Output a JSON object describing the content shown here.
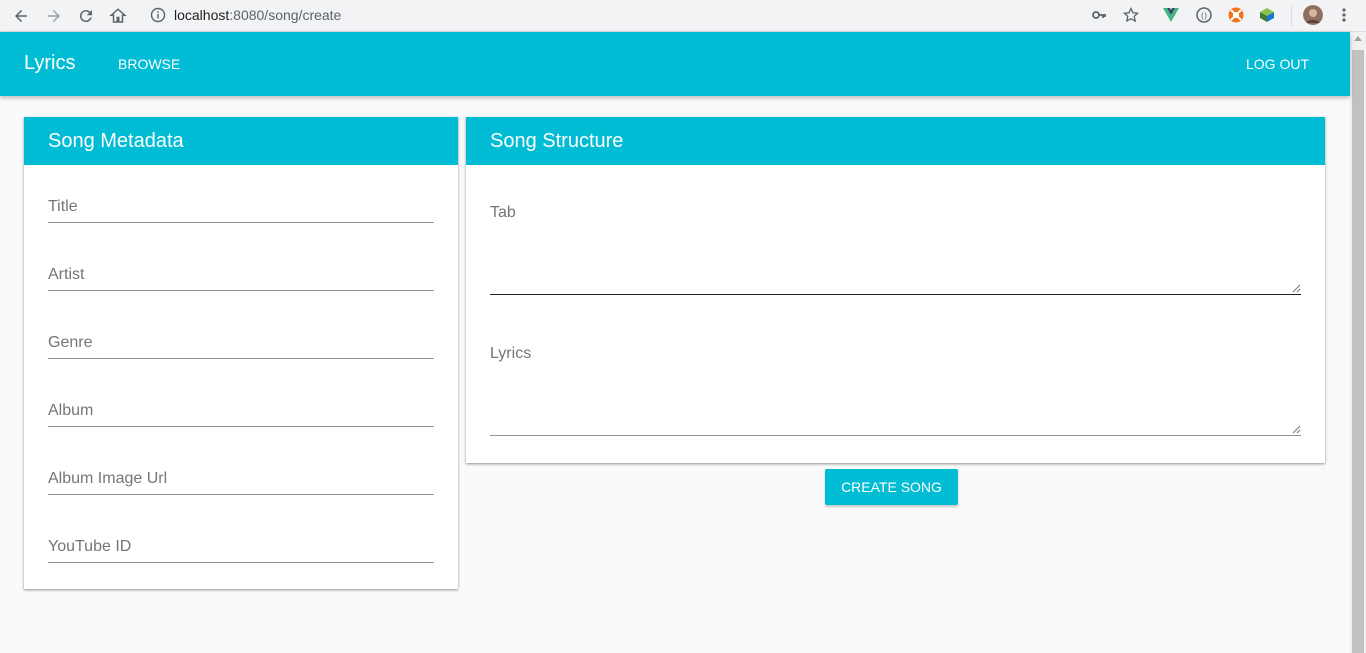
{
  "browser": {
    "url_host": "localhost",
    "url_rest": ":8080/song/create"
  },
  "toolbar": {
    "brand": "Lyrics",
    "browse_label": "BROWSE",
    "logout_label": "LOG OUT"
  },
  "metadata_card": {
    "title": "Song Metadata",
    "fields": {
      "title": "Title",
      "artist": "Artist",
      "genre": "Genre",
      "album": "Album",
      "album_image_url": "Album Image Url",
      "youtube_id": "YouTube ID"
    }
  },
  "structure_card": {
    "title": "Song Structure",
    "tab_placeholder": "Tab",
    "lyrics_placeholder": "Lyrics"
  },
  "create_button": "CREATE SONG",
  "colors": {
    "primary": "#00bcd4",
    "background": "#fafafa"
  }
}
